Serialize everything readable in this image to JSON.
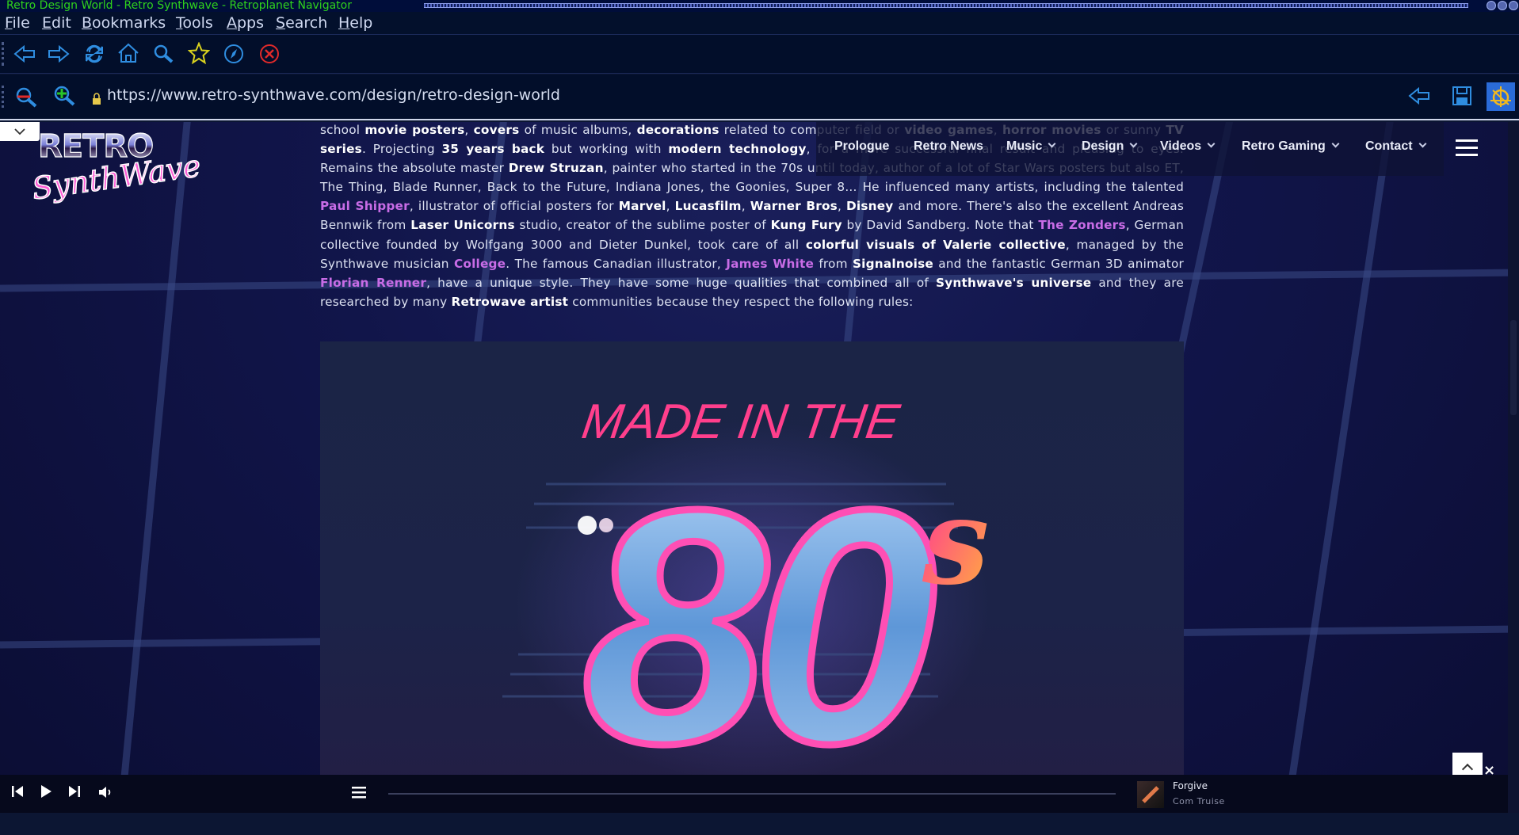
{
  "window": {
    "title": "Retro Design World - Retro Synthwave - Retroplanet Navigator"
  },
  "menu": {
    "items": [
      {
        "label": "File",
        "accel": "F",
        "rest": "ile"
      },
      {
        "label": "Edit",
        "accel": "E",
        "rest": "dit"
      },
      {
        "label": "Bookmarks",
        "accel": "B",
        "rest": "ookmarks"
      },
      {
        "label": "Tools",
        "accel": "T",
        "rest": "ools"
      },
      {
        "label": "Apps",
        "accel": "A",
        "rest": "pps"
      },
      {
        "label": "Search",
        "accel": "S",
        "rest": "earch"
      },
      {
        "label": "Help",
        "accel": "H",
        "rest": "elp"
      }
    ]
  },
  "toolbar": {
    "icons": [
      "back-icon",
      "forward-icon",
      "reload-icon",
      "home-icon",
      "search-icon",
      "bookmark-star-icon",
      "compass-icon",
      "stop-icon"
    ]
  },
  "address": {
    "url": "https://www.retro-synthwave.com/design/retro-design-world",
    "left_icons": [
      "search-page-icon",
      "add-bookmark-icon"
    ],
    "secure_icon": "lock-icon",
    "right_icons": [
      "go-back-arrow-icon",
      "save-icon",
      "profile-icon"
    ]
  },
  "site": {
    "logo_line1": "RETRO",
    "logo_line2": "SynthWave",
    "nav": [
      {
        "label": "Prologue",
        "dropdown": false
      },
      {
        "label": "Retro News",
        "dropdown": false
      },
      {
        "label": "Music",
        "dropdown": true
      },
      {
        "label": "Design",
        "dropdown": true
      },
      {
        "label": "Videos",
        "dropdown": true
      },
      {
        "label": "Retro Gaming",
        "dropdown": true
      },
      {
        "label": "Contact",
        "dropdown": true
      }
    ]
  },
  "article": {
    "segments": [
      {
        "t": "school ",
        "s": "n"
      },
      {
        "t": "movie posters",
        "s": "b"
      },
      {
        "t": ", ",
        "s": "n"
      },
      {
        "t": "covers",
        "s": "b"
      },
      {
        "t": " of music albums, ",
        "s": "n"
      },
      {
        "t": "decorations",
        "s": "b"
      },
      {
        "t": " related to computer field or ",
        "s": "n"
      },
      {
        "t": "video games",
        "s": "b"
      },
      {
        "t": ", ",
        "s": "n"
      },
      {
        "t": "horror movies",
        "s": "b"
      },
      {
        "t": " or sunny ",
        "s": "n"
      },
      {
        "t": "TV series",
        "s": "b"
      },
      {
        "t": ". Projecting ",
        "s": "n"
      },
      {
        "t": "35 years back",
        "s": "b"
      },
      {
        "t": " but working with ",
        "s": "n"
      },
      {
        "t": "modern technology",
        "s": "b"
      },
      {
        "t": ", for a more successful final result and pleasing to eyes. Remains the absolute master ",
        "s": "n"
      },
      {
        "t": "Drew Struzan",
        "s": "b"
      },
      {
        "t": ", painter who started in the 70s until today, author of a lot of Star Wars posters but also ET, The Thing, Blade Runner, Back to the Future, Indiana Jones, the Goonies, Super 8... He influenced many artists, including the talented ",
        "s": "n"
      },
      {
        "t": "Paul Shipper",
        "s": "a"
      },
      {
        "t": ", illustrator of official posters for ",
        "s": "n"
      },
      {
        "t": "Marvel",
        "s": "b"
      },
      {
        "t": ", ",
        "s": "n"
      },
      {
        "t": "Lucasfilm",
        "s": "b"
      },
      {
        "t": ", ",
        "s": "n"
      },
      {
        "t": "Warner Bros",
        "s": "b"
      },
      {
        "t": ", ",
        "s": "n"
      },
      {
        "t": "Disney",
        "s": "b"
      },
      {
        "t": " and more. There's also the excellent Andreas Bennwik from ",
        "s": "n"
      },
      {
        "t": "Laser Unicorns",
        "s": "b"
      },
      {
        "t": " studio, creator of the sublime poster of ",
        "s": "n"
      },
      {
        "t": "Kung Fury",
        "s": "b"
      },
      {
        "t": " by David Sandberg. Note that ",
        "s": "n"
      },
      {
        "t": "The Zonders",
        "s": "a"
      },
      {
        "t": ", German collective founded by Wolfgang 3000 and Dieter Dunkel, took care of all ",
        "s": "n"
      },
      {
        "t": "colorful visuals of Valerie collective",
        "s": "b"
      },
      {
        "t": ", managed by the Synthwave musician ",
        "s": "n"
      },
      {
        "t": "College",
        "s": "a"
      },
      {
        "t": ". The famous Canadian illustrator, ",
        "s": "n"
      },
      {
        "t": "James White",
        "s": "a"
      },
      {
        "t": " from ",
        "s": "n"
      },
      {
        "t": "Signalnoise",
        "s": "b"
      },
      {
        "t": " and the fantastic German 3D animator ",
        "s": "n"
      },
      {
        "t": "Florian Renner",
        "s": "a"
      },
      {
        "t": ", have a unique style. They have some huge qualities that combined all of ",
        "s": "n"
      },
      {
        "t": "Synthwave's universe",
        "s": "b"
      },
      {
        "t": " and they are researched by many ",
        "s": "n"
      },
      {
        "t": "Retrowave artist",
        "s": "b"
      },
      {
        "t": " communities because they respect the following rules:",
        "s": "n"
      }
    ]
  },
  "hero": {
    "headline": "MADE IN THE",
    "big_text": "80",
    "suffix": "s"
  },
  "player": {
    "track_title": "Forgive",
    "track_artist": "Com Truise",
    "controls": [
      "previous-icon",
      "play-icon",
      "next-icon",
      "volume-icon",
      "playlist-icon"
    ]
  },
  "colors": {
    "link": "#c86ce6",
    "neon_pink": "#ff2fa0",
    "chrome_blue": "#7fb3ea",
    "page_bg": "#11154a"
  }
}
